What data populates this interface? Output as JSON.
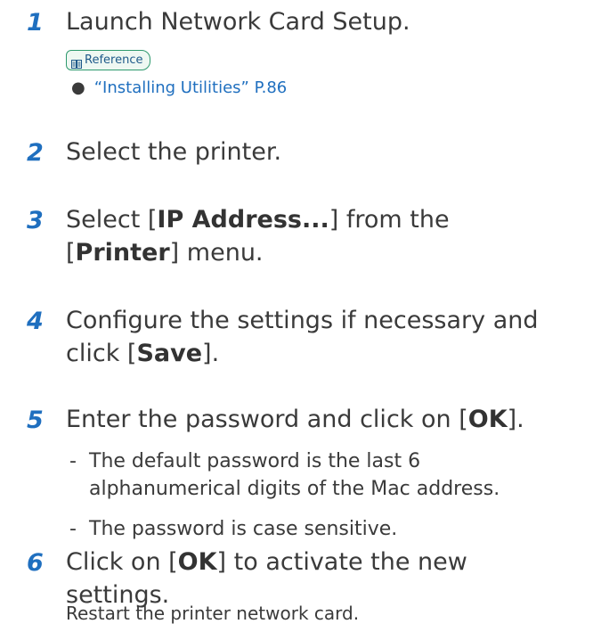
{
  "steps": [
    {
      "num": "1",
      "text": "Launch Network Card Setup."
    },
    {
      "num": "2",
      "text": "Select the printer."
    },
    {
      "num": "3",
      "line1_pre": "Select [",
      "line1_bold": "IP Address...",
      "line1_post": "] from the",
      "line2_pre": "[",
      "line2_bold": "Printer",
      "line2_post": "] menu."
    },
    {
      "num": "4",
      "line1": "Configure the settings if necessary and",
      "line2_pre": "click [",
      "line2_bold": "Save",
      "line2_post": "]."
    },
    {
      "num": "5",
      "pre": "Enter the password and click on [",
      "bold": "OK",
      "post": "]."
    },
    {
      "num": "6",
      "line1_pre": "Click on [",
      "line1_bold": "OK",
      "line1_post": "] to activate the new",
      "line2": "settings."
    }
  ],
  "reference": {
    "badge_label": "Reference",
    "bullet": "●",
    "link_text": "“Installing Utilities” P.86"
  },
  "notes": [
    {
      "dash": "-",
      "line1": "The default password is the last 6",
      "line2": "alphanumerical digits of the Mac address."
    },
    {
      "dash": "-",
      "line1": "The password is case sensitive."
    }
  ],
  "step6_sub": "Restart the printer network card.",
  "colors": {
    "step_number": "#1f6fbf",
    "link": "#1f6fbf",
    "badge_border": "#2f9a6e"
  }
}
